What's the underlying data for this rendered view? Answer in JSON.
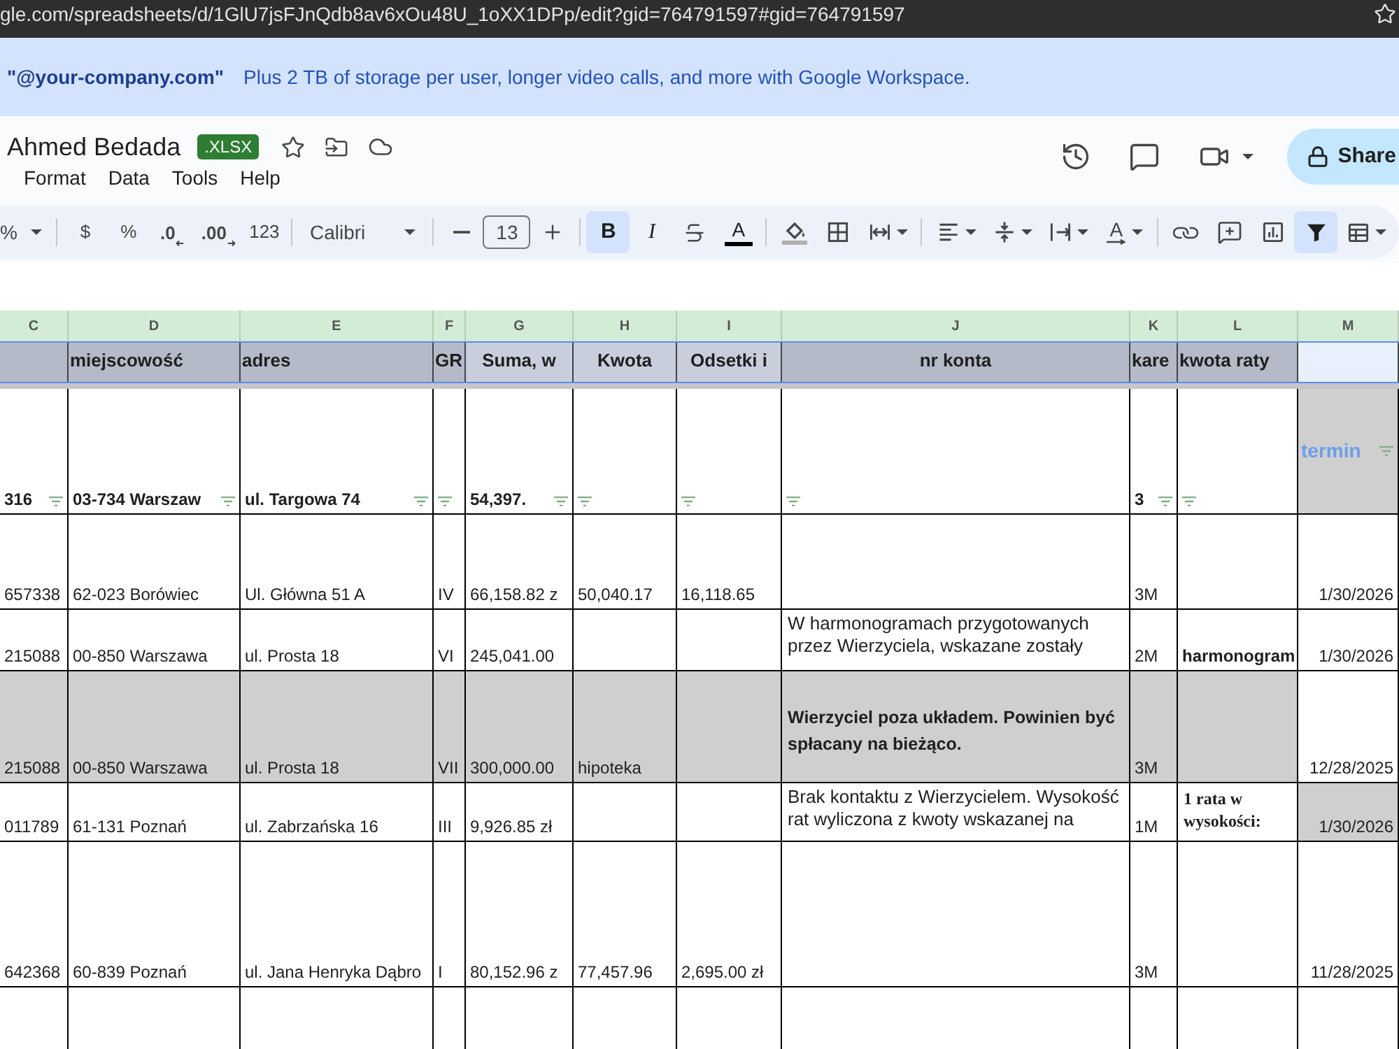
{
  "browser": {
    "url": "gle.com/spreadsheets/d/1GlU7jsFJnQdb8av6xOu48U_1oXX1DPp/edit?gid=764791597#gid=764791597"
  },
  "banner": {
    "domain": "\"@your-company.com\"",
    "message": "Plus 2 TB of storage per user, longer video calls, and more with Google Workspace."
  },
  "document": {
    "title": "Ahmed Bedada",
    "file_type": ".XLSX",
    "menu": [
      "Format",
      "Data",
      "Tools",
      "Help"
    ],
    "share": "Share"
  },
  "toolbar": {
    "zoom": "%",
    "number_formats": [
      {
        "kind": "text",
        "label": "$"
      },
      {
        "kind": "text",
        "label": "%"
      },
      {
        "kind": "decrease",
        "label": ".0"
      },
      {
        "kind": "increase",
        "label": ".00"
      },
      {
        "kind": "text",
        "label": "123"
      }
    ],
    "font": "Calibri",
    "font_size": "13",
    "styles": [
      {
        "label": "B",
        "active": true
      },
      {
        "label": "I",
        "active": false
      }
    ],
    "text_color": "A",
    "rotation": "A",
    "filter_active": true
  },
  "sheet": {
    "columns": [
      "C",
      "D",
      "E",
      "F",
      "G",
      "H",
      "I",
      "J",
      "K",
      "L",
      "M"
    ],
    "header_row": [
      {
        "color": "#b5bac9"
      },
      {
        "text": "miejscowość",
        "color": "#b5bac9"
      },
      {
        "text": "adres",
        "color": "#b5bac9"
      },
      {
        "text": "GR",
        "color": "#b5bac9"
      },
      {
        "text": "Suma, w",
        "color": "#c9cedd"
      },
      {
        "text": "Kwota",
        "color": "#c9cedd"
      },
      {
        "text": "Odsetki i",
        "color": "#c9cedd"
      },
      {
        "text": "nr konta",
        "color": "#b5bac9"
      },
      {
        "text": "kare",
        "color": "#b5bac9"
      },
      {
        "text": "kwota raty",
        "color": "#b5bac9"
      },
      {
        "color": "#e8f0fe"
      }
    ],
    "rows": [
      {
        "filtered": true,
        "cells": [
          {
            "kind": "strong",
            "text": "316",
            "shaded": false
          },
          {
            "kind": "strong",
            "text": "03-734 Warszaw",
            "shaded": false
          },
          {
            "kind": "strong",
            "text": "ul. Targowa 74",
            "shaded": false
          },
          {
            "kind": "blank",
            "shaded": false
          },
          {
            "kind": "strong",
            "text": "54,397.",
            "shaded": false
          },
          {
            "kind": "blank",
            "shaded": false
          },
          {
            "kind": "blank",
            "shaded": false
          },
          {
            "kind": "blank",
            "shaded": false
          },
          {
            "kind": "strong",
            "text": "3",
            "shaded": false
          },
          {
            "kind": "blank",
            "shaded": false
          },
          {
            "kind": "accent",
            "text": "termin",
            "shaded": true
          }
        ]
      },
      {
        "filtered": false,
        "cells": [
          {
            "kind": "plain",
            "text": "657338",
            "shaded": false
          },
          {
            "kind": "plain",
            "text": "62-023 Borówiec",
            "shaded": false
          },
          {
            "kind": "plain",
            "text": "Ul. Główna 51 A",
            "shaded": false
          },
          {
            "kind": "plain",
            "text": "IV",
            "shaded": false
          },
          {
            "kind": "plain",
            "text": "66,158.82 z",
            "shaded": false
          },
          {
            "kind": "plain",
            "text": "50,040.17",
            "shaded": false
          },
          {
            "kind": "plain",
            "text": "16,118.65",
            "shaded": false
          },
          {
            "kind": "blank",
            "shaded": false
          },
          {
            "kind": "plain",
            "text": "3M",
            "shaded": false
          },
          {
            "kind": "blank",
            "shaded": false
          },
          {
            "kind": "date",
            "text": "1/30/2026",
            "shaded": false
          }
        ]
      },
      {
        "filtered": false,
        "cells": [
          {
            "kind": "plain",
            "text": "215088",
            "shaded": false
          },
          {
            "kind": "plain",
            "text": "00-850 Warszawa",
            "shaded": false
          },
          {
            "kind": "plain",
            "text": "ul. Prosta 18",
            "shaded": false
          },
          {
            "kind": "plain",
            "text": "VI",
            "shaded": false
          },
          {
            "kind": "plain",
            "text": "245,041.00",
            "shaded": false
          },
          {
            "kind": "blank",
            "shaded": false
          },
          {
            "kind": "blank",
            "shaded": false
          },
          {
            "kind": "wrap",
            "text": "W harmonogramach przygotowanych przez Wierzyciela, wskazane zostały",
            "shaded": false
          },
          {
            "kind": "plain",
            "text": "2M",
            "shaded": false
          },
          {
            "kind": "strong",
            "text": "harmonogram",
            "shaded": false
          },
          {
            "kind": "date",
            "text": "1/30/2026",
            "shaded": false
          }
        ]
      },
      {
        "filtered": false,
        "cells": [
          {
            "kind": "plain",
            "text": "215088",
            "shaded": true
          },
          {
            "kind": "plain",
            "text": "00-850 Warszawa",
            "shaded": true
          },
          {
            "kind": "plain",
            "text": "ul. Prosta 18",
            "shaded": true
          },
          {
            "kind": "plain",
            "text": "VII",
            "shaded": true
          },
          {
            "kind": "plain",
            "text": "300,000.00",
            "shaded": true
          },
          {
            "kind": "plain",
            "text": "hipoteka",
            "shaded": true
          },
          {
            "kind": "blank",
            "shaded": true
          },
          {
            "kind": "emph",
            "text": "Wierzyciel poza układem. Powinien być spłacany na bieżąco.",
            "shaded": true
          },
          {
            "kind": "plain",
            "text": "3M",
            "shaded": true
          },
          {
            "kind": "blank",
            "shaded": true
          },
          {
            "kind": "date",
            "text": "12/28/2025",
            "shaded": false
          }
        ]
      },
      {
        "filtered": false,
        "cells": [
          {
            "kind": "plain",
            "text": "011789",
            "shaded": false
          },
          {
            "kind": "plain",
            "text": "61-131 Poznań",
            "shaded": false
          },
          {
            "kind": "plain",
            "text": "ul. Zabrzańska 16",
            "shaded": false
          },
          {
            "kind": "plain",
            "text": "III",
            "shaded": false
          },
          {
            "kind": "plain",
            "text": "9,926.85 zł",
            "shaded": false
          },
          {
            "kind": "blank",
            "shaded": false
          },
          {
            "kind": "blank",
            "shaded": false
          },
          {
            "kind": "wrap",
            "text": "Brak kontaktu z Wierzycielem. Wysokość rat wyliczona z kwoty wskazanej na",
            "shaded": false
          },
          {
            "kind": "plain",
            "text": "1M",
            "shaded": false
          },
          {
            "kind": "serif",
            "text": "1 rata w wysokości:",
            "shaded": false
          },
          {
            "kind": "date",
            "text": "1/30/2026",
            "shaded": true
          }
        ]
      },
      {
        "filtered": false,
        "cells": [
          {
            "kind": "plain",
            "text": "642368",
            "shaded": false
          },
          {
            "kind": "plain",
            "text": "60-839 Poznań",
            "shaded": false
          },
          {
            "kind": "plain",
            "text": "ul. Jana Henryka Dąbro",
            "shaded": false
          },
          {
            "kind": "plain",
            "text": "I",
            "shaded": false
          },
          {
            "kind": "plain",
            "text": "80,152.96 z",
            "shaded": false
          },
          {
            "kind": "plain",
            "text": "77,457.96",
            "shaded": false
          },
          {
            "kind": "plain",
            "text": "2,695.00 zł",
            "shaded": false
          },
          {
            "kind": "blank",
            "shaded": false
          },
          {
            "kind": "plain",
            "text": "3M",
            "shaded": false
          },
          {
            "kind": "blank",
            "shaded": false
          },
          {
            "kind": "date",
            "text": "11/28/2025",
            "shaded": false
          }
        ]
      }
    ]
  }
}
